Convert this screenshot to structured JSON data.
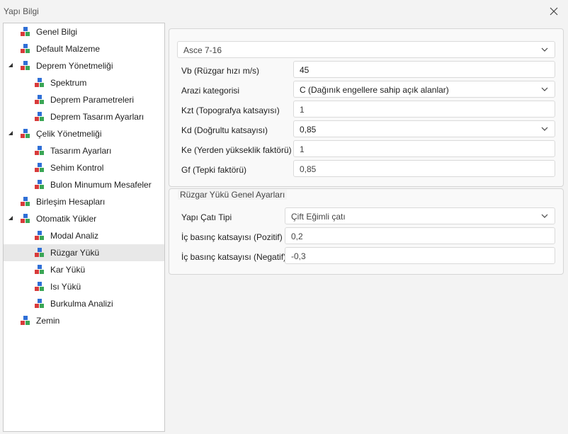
{
  "window": {
    "title": "Yapı Bilgi"
  },
  "tree": {
    "items": [
      {
        "label": "Genel Bilgi"
      },
      {
        "label": "Default Malzeme"
      },
      {
        "label": "Deprem Yönetmeliği"
      },
      {
        "label": "Spektrum"
      },
      {
        "label": "Deprem Parametreleri"
      },
      {
        "label": "Deprem Tasarım Ayarları"
      },
      {
        "label": "Çelik Yönetmeliği"
      },
      {
        "label": "Tasarım Ayarları"
      },
      {
        "label": "Sehim Kontrol"
      },
      {
        "label": "Bulon Minumum Mesafeler"
      },
      {
        "label": "Birleşim Hesapları"
      },
      {
        "label": "Otomatik Yükler"
      },
      {
        "label": "Modal Analiz"
      },
      {
        "label": "Rüzgar Yükü"
      },
      {
        "label": "Kar Yükü"
      },
      {
        "label": "Isı Yükü"
      },
      {
        "label": "Burkulma Analizi"
      },
      {
        "label": "Zemin"
      }
    ],
    "selected": "Rüzgar Yükü"
  },
  "wind_code": {
    "selected": "Asce 7-16"
  },
  "params": {
    "vb_label": "Vb (Rüzgar hızı m/s)",
    "vb_value": "45",
    "terrain_label": "Arazi kategorisi",
    "terrain_value": "C (Dağınık engellere sahip  açık alanlar)",
    "kzt_label": "Kzt (Topografya katsayısı)",
    "kzt_value": "1",
    "kd_label": "Kd (Doğrultu katsayısı)",
    "kd_value": "0,85",
    "ke_label": "Ke (Yerden yükseklik faktörü)",
    "ke_value": "1",
    "gf_label": "Gf (Tepki faktörü)",
    "gf_value": "0,85"
  },
  "general": {
    "title": "Rüzgar Yükü Genel Ayarları",
    "roof_label": "Yapı Çatı Tipi",
    "roof_value": "Çift Eğimli çatı",
    "pos_label": "İç basınç katsayısı (Pozitif)",
    "pos_value": "0,2",
    "neg_label": "İç basınç katsayısı (Negatif)",
    "neg_value": "-0,3"
  },
  "colors": {
    "icon_blue": "#2f6fd6",
    "icon_red": "#d83b3b",
    "icon_green": "#3aa655",
    "selected_bg": "#e8e8e8"
  }
}
